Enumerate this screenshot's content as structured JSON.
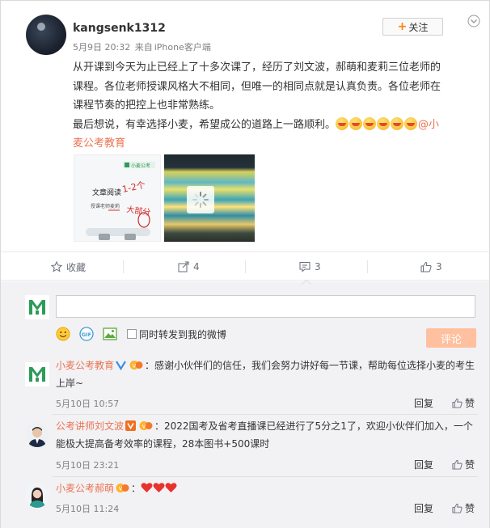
{
  "post": {
    "username": "kangsenk1312",
    "date": "5月9日 20:32",
    "source_prefix": "来自",
    "source": "iPhone客户端",
    "follow_label": "关注",
    "lines": [
      "从开课到今天为止已经上了十多次课了，经历了刘文波，郝萌和麦莉三位老师的",
      "课程。各位老师授课风格大不相同，但唯一的相同点就是认真负责。各位老师在",
      "课程节奏的把控上也非常熟练。"
    ],
    "line4": "最后想说，有幸选择小麦，希望成公的道路上一路顺利。",
    "mention_a": "@小",
    "mention_b": "麦公考教育",
    "image1_text": {
      "title": "文章阅读",
      "sub1": "授课老师",
      "sub2": "麦莉",
      "brand": "小麦公考",
      "hand1": "1-2个",
      "hand2": "大部分"
    }
  },
  "actions": {
    "favorite": "收藏",
    "forward": "4",
    "comment": "3",
    "like": "3"
  },
  "composer": {
    "forward_label": "同时转发到我的微博",
    "submit_label": "评论"
  },
  "comments": [
    {
      "name": "小麦公考教育",
      "text1": "：感谢小伙伴们的信任，我们会努力讲好每一节课，帮助每位选择小麦的考生",
      "text2": "上岸~",
      "date": "5月10日 10:57",
      "reply": "回复",
      "like": "赞"
    },
    {
      "name": "公考讲师刘文波",
      "text1": "：2022国考及省考直播课已经进行了5分之1了，欢迎小伙伴们加入，一个",
      "text2": "能极大提高备考效率的课程，28本图书+500课时",
      "date": "5月10日 23:21",
      "reply": "回复",
      "like": "赞"
    },
    {
      "name": "小麦公考郝萌",
      "text1": "：",
      "date": "5月10日 11:24",
      "reply": "回复",
      "like": "赞"
    }
  ],
  "colors": {
    "accent": "#eb7350",
    "follow_plus": "#ff8200",
    "submit_bg": "#ffc09f",
    "comment_bg": "#f2f2f5",
    "logo_green": "#2e9b5b",
    "heart": "#e8322d"
  },
  "icons": [
    "chevron-down-icon",
    "star-icon",
    "forward-icon",
    "comment-icon",
    "thumbs-up-icon",
    "emoji-icon",
    "gif-icon",
    "picture-icon",
    "verified-icon",
    "vip-icon",
    "heart-icon",
    "loading-icon"
  ]
}
